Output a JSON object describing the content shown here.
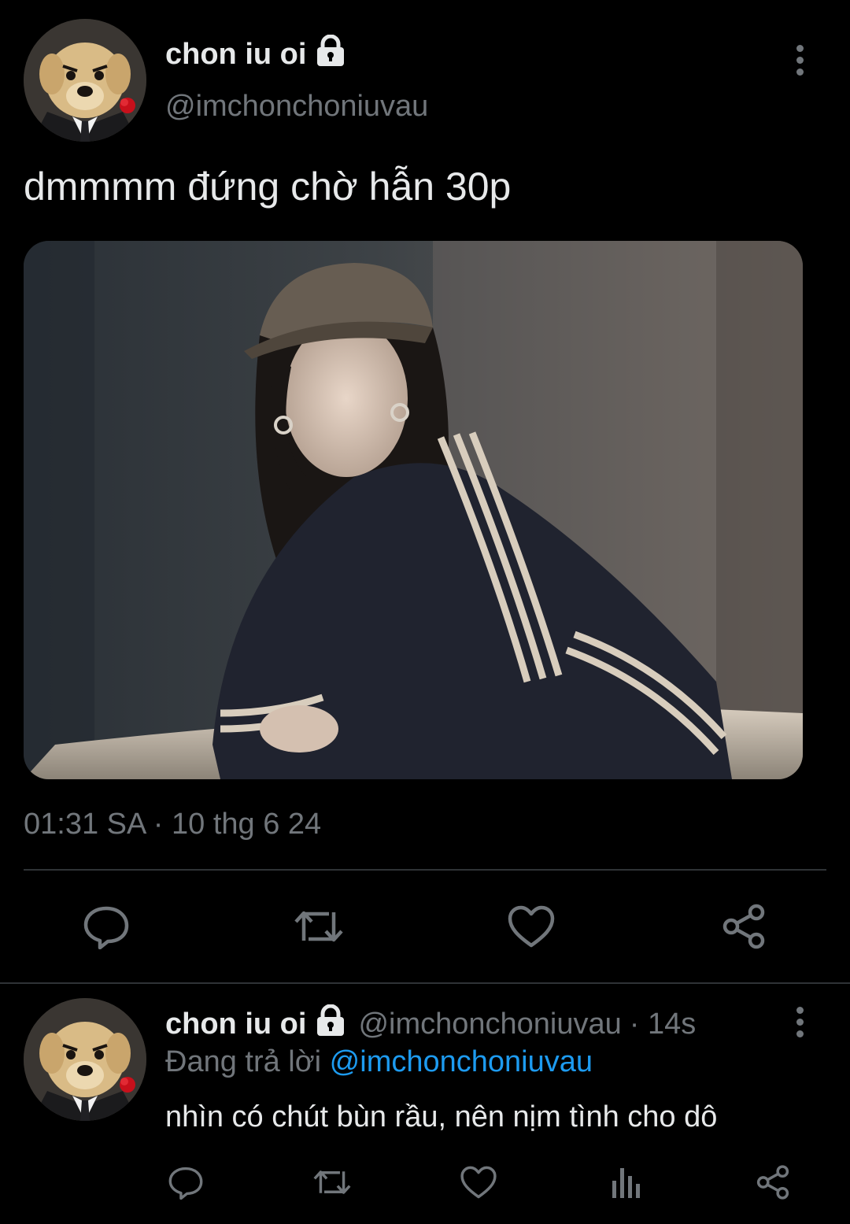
{
  "tweet": {
    "display_name": "chon iu oi",
    "handle": "@imchonchoniuvau",
    "text": "dmmmm đứng chờ hẫn 30p",
    "timestamp": "01:31 SA · 10 thg 6 24",
    "avatar_icon": "dog-avatar",
    "locked_icon": "lock-icon",
    "photo_description_icon": "photo"
  },
  "reply": {
    "display_name": "chon iu oi",
    "handle": "@imchonchoniuvau",
    "time": "· 14s",
    "replying_prefix": "Đang trả lời",
    "replying_mention": "@imchonchoniuvau",
    "text": "nhìn có chút bùn rầu, nên nịm tình cho dô"
  },
  "colors": {
    "background": "#000000",
    "text": "#e7e9ea",
    "secondary": "#71767b",
    "accent": "#1d9bf0",
    "divider": "#2f3336"
  },
  "actions": [
    "reply-icon",
    "retweet-icon",
    "like-icon",
    "share-icon"
  ],
  "reply_actions": [
    "reply-icon",
    "retweet-icon",
    "like-icon",
    "analytics-icon",
    "share-icon"
  ]
}
